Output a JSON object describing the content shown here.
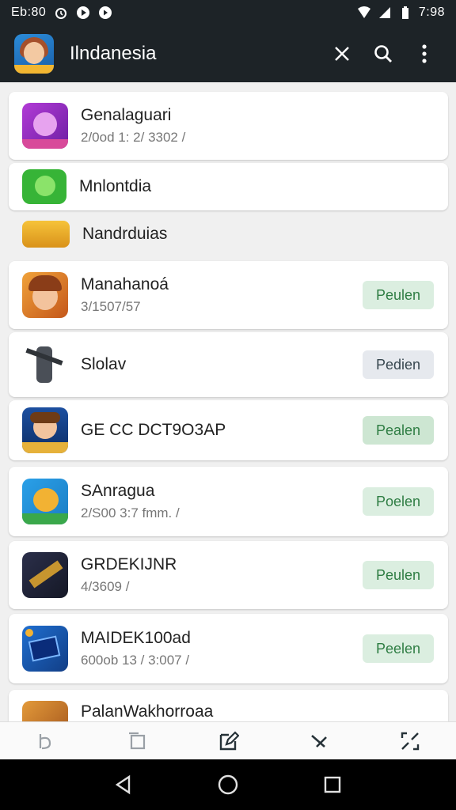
{
  "status_bar": {
    "left_text": "Eb:80",
    "icons": [
      "alarm-icon",
      "play-icon",
      "play-circle-icon"
    ],
    "right_icons": [
      "wifi-icon",
      "signal-icon",
      "battery-icon"
    ],
    "time": "7:98"
  },
  "app_bar": {
    "title": "Ilndanesia",
    "icons": [
      "close-icon",
      "search-icon",
      "more-vert-icon"
    ]
  },
  "list": [
    {
      "name": "Genalaguari",
      "sub": "2/0od 1: 2/ 3302 /",
      "button": ""
    },
    {
      "name": "Mnlontdia",
      "sub": "",
      "button": ""
    },
    {
      "name": "Nandrduias",
      "sub": "",
      "button": ""
    },
    {
      "name": "Manahanoá",
      "sub": "3/1507/57",
      "button": "Peulen"
    },
    {
      "name": "Slolav",
      "sub": "",
      "button": "Pedien"
    },
    {
      "name": "GE CC DCT9O3AP",
      "sub": "",
      "button": "Pealen"
    },
    {
      "name": "SAnragua",
      "sub": "2/S00 3:7 fmm. /",
      "button": "Poelen"
    },
    {
      "name": "GRDEKIJNR",
      "sub": "4/3609 /",
      "button": "Peulen"
    },
    {
      "name": "MAIDEK100ad",
      "sub": "600ob 13 / 3:007 /",
      "button": "Peelen"
    },
    {
      "name": "PalanWakhorroaa",
      "sub": "",
      "button": ""
    }
  ],
  "bottom_tabs": [
    "undo-icon",
    "copy-icon",
    "edit-icon",
    "tools-icon",
    "expand-icon"
  ],
  "nav_bar": [
    "back-icon",
    "home-icon",
    "recents-icon"
  ],
  "colors": {
    "bar": "#1d2327",
    "button_bg": "#dbeee0",
    "button_text": "#2e7d43"
  }
}
